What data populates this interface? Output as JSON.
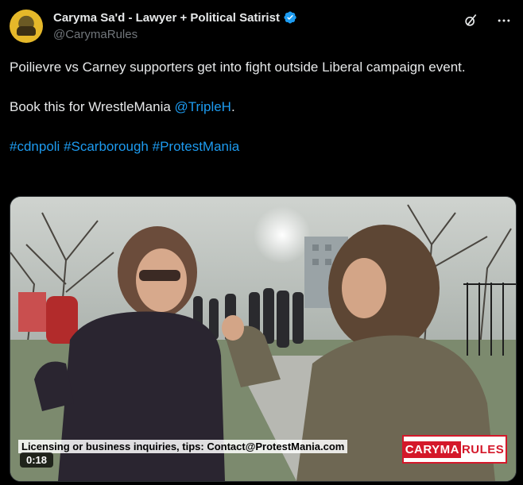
{
  "author": {
    "display_name": "Caryma Sa'd - Lawyer + Political Satirist",
    "handle": "@CarymaRules",
    "verified": true,
    "avatar_icon": "avatar-image"
  },
  "header_icons": [
    "grok-icon",
    "more-icon"
  ],
  "tweet": {
    "line1": "Poilievre vs Carney supporters get into fight outside Liberal campaign event.",
    "line2_prefix": "Book this for WrestleMania ",
    "line2_mention": "@TripleH",
    "line2_suffix": ".",
    "hashtags": [
      "#cdnpoli",
      "#Scarborough",
      "#ProtestMania"
    ]
  },
  "media": {
    "caption": "Licensing or business inquiries, tips: Contact@ProtestMania.com",
    "brand_part1": "CARYMA",
    "brand_part2": "RULES",
    "duration": "0:18"
  },
  "colors": {
    "background": "#000000",
    "text": "#e7e9ea",
    "muted": "#71767b",
    "link": "#1d9bf0",
    "brand_red": "#d4182a"
  }
}
